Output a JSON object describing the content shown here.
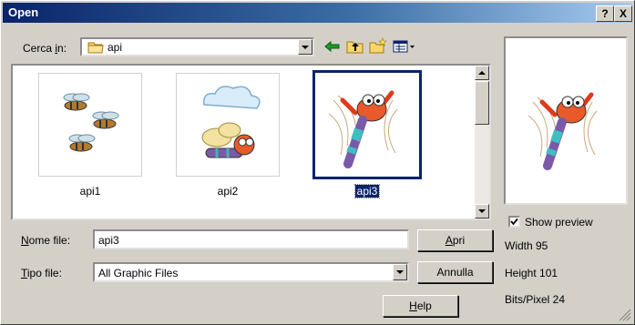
{
  "window": {
    "title": "Open",
    "help_glyph": "?",
    "close_glyph": "X"
  },
  "look_in": {
    "label_pre": "Cerca ",
    "label_key": "i",
    "label_post": "n:",
    "value": "api"
  },
  "files": [
    {
      "name": "api1",
      "selected": false
    },
    {
      "name": "api2",
      "selected": false
    },
    {
      "name": "api3",
      "selected": true
    }
  ],
  "filename": {
    "label_key": "N",
    "label_rest": "ome file:",
    "value": "api3"
  },
  "filetype": {
    "label_key": "T",
    "label_rest": "ipo file:",
    "value": "All Graphic Files"
  },
  "buttons": {
    "open_key": "A",
    "open_rest": "pri",
    "cancel": "Annulla",
    "help_key": "H",
    "help_rest": "elp"
  },
  "preview": {
    "show_label": "Show preview",
    "checked": true,
    "width": "Width 95",
    "height": "Height 101",
    "bits": "Bits/Pixel 24"
  },
  "colors": {
    "selection": "#0a246a",
    "face": "#d4d0c8"
  }
}
